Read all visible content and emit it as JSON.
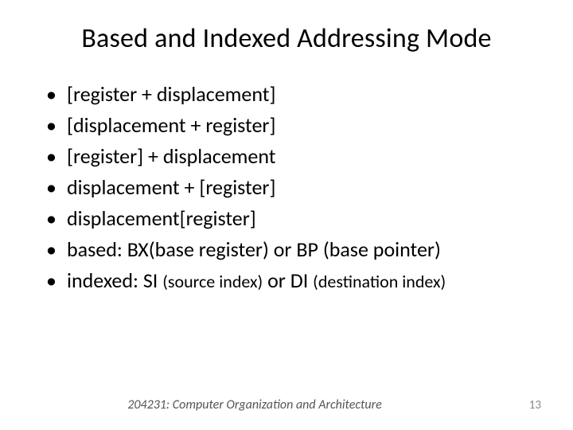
{
  "title": "Based and Indexed Addressing Mode",
  "bullets": [
    "[register + displacement]",
    "[displacement  + register]",
    "[register] + displacement",
    "displacement + [register]",
    "displacement[register]"
  ],
  "bullet_based_prefix": "based: BX(base register) or BP (base pointer)",
  "bullet_indexed_main": "indexed: SI ",
  "bullet_indexed_small1": "(source index)",
  "bullet_indexed_mid": " or DI ",
  "bullet_indexed_small2": "(destination index)",
  "footer_center": "204231: Computer Organization and Architecture",
  "footer_right": "13"
}
